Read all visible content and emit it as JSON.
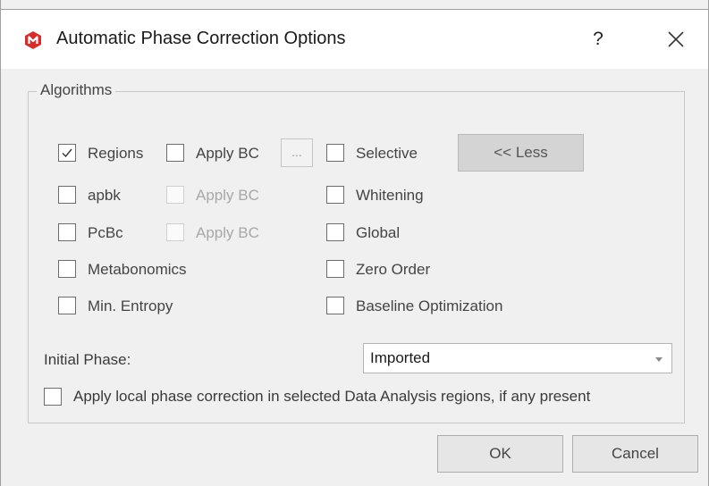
{
  "window": {
    "title": "Automatic Phase Correction Options",
    "help_label": "?",
    "app_icon": "magnetic-resonance-logo-icon",
    "brand_color": "#d32f2f"
  },
  "algorithms": {
    "group_label": "Algorithms",
    "left_column": [
      {
        "label": "Regions",
        "checked": true
      },
      {
        "label": "apbk",
        "checked": false
      },
      {
        "label": "PcBc",
        "checked": false
      },
      {
        "label": "Metabonomics",
        "checked": false
      },
      {
        "label": "Min. Entropy",
        "checked": false
      }
    ],
    "apply_bc": [
      {
        "label": "Apply BC",
        "checked": false,
        "enabled": true
      },
      {
        "label": "Apply BC",
        "checked": false,
        "enabled": false
      },
      {
        "label": "Apply BC",
        "checked": false,
        "enabled": false
      }
    ],
    "ellipsis_label": "...",
    "right_column": [
      {
        "label": "Selective",
        "checked": false
      },
      {
        "label": "Whitening",
        "checked": false
      },
      {
        "label": "Global",
        "checked": false
      },
      {
        "label": "Zero Order",
        "checked": false
      },
      {
        "label": "Baseline Optimization",
        "checked": false
      }
    ],
    "less_button_label": "<< Less"
  },
  "initial_phase": {
    "label": "Initial Phase:",
    "selected": "Imported"
  },
  "local_phase": {
    "label": "Apply local phase correction in selected Data Analysis regions, if any present",
    "checked": false
  },
  "buttons": {
    "ok": "OK",
    "cancel": "Cancel"
  }
}
